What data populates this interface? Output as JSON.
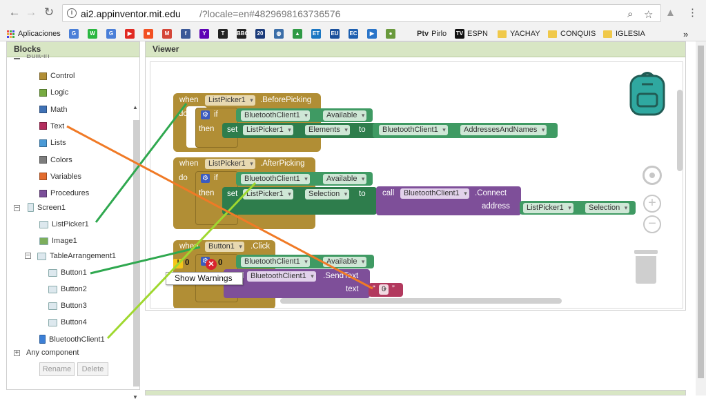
{
  "browser": {
    "url_host": "ai2.appinventor.mit.edu",
    "url_rest": "/?locale=en#4829698163736576",
    "back_icon": "arrow-left-icon",
    "forward_icon": "arrow-right-icon",
    "reload_icon": "reload-icon"
  },
  "bookmarks": {
    "apps_label": "Aplicaciones",
    "items": [
      {
        "label": "",
        "icon": "translate-icon",
        "color": "#4a7fd8",
        "glyph": "G"
      },
      {
        "label": "",
        "icon": "whatsapp-icon",
        "color": "#2bb741",
        "glyph": "W"
      },
      {
        "label": "",
        "icon": "translate-icon-2",
        "color": "#4a7fd8",
        "glyph": "G"
      },
      {
        "label": "",
        "icon": "youtube-icon",
        "color": "#e12a23",
        "glyph": "▶"
      },
      {
        "label": "",
        "icon": "microsoft-icon",
        "color": "#f25022",
        "glyph": "■"
      },
      {
        "label": "",
        "icon": "gmail-icon",
        "color": "#d44638",
        "glyph": "M"
      },
      {
        "label": "",
        "icon": "facebook-icon",
        "color": "#3b5998",
        "glyph": "f"
      },
      {
        "label": "",
        "icon": "yahoo-icon",
        "color": "#5f02b5",
        "glyph": "Y"
      },
      {
        "label": "",
        "icon": "nytimes-icon",
        "color": "#222222",
        "glyph": "T"
      },
      {
        "label": "",
        "icon": "bbc-icon",
        "color": "#222222",
        "glyph": "BBC"
      },
      {
        "label": "",
        "icon": "20min-icon",
        "color": "#1b3b7a",
        "glyph": "20"
      },
      {
        "label": "",
        "icon": "globe-icon",
        "color": "#3b6ea8",
        "glyph": "◍"
      },
      {
        "label": "",
        "icon": "photo-icon",
        "color": "#2f9a45",
        "glyph": "▲"
      },
      {
        "label": "",
        "icon": "et-icon",
        "color": "#1a76c2",
        "glyph": "ET"
      },
      {
        "label": "",
        "icon": "eu-icon",
        "color": "#1a4f9b",
        "glyph": "EU"
      },
      {
        "label": "",
        "icon": "ec-icon",
        "color": "#1d5fb0",
        "glyph": "EC"
      },
      {
        "label": "",
        "icon": "play-icon",
        "color": "#2a75c9",
        "glyph": "▶"
      },
      {
        "label": "",
        "icon": "circle-icon",
        "color": "#6a9a3d",
        "glyph": "●"
      }
    ],
    "pirlo": "Pirlo",
    "espn": "ESPN",
    "yachay": "YACHAY",
    "conquis": "CONQUIS",
    "iglesia": "IGLESIA",
    "more": "»"
  },
  "blocks_panel": {
    "title": "Blocks",
    "builtin": "Built-in",
    "categories": [
      {
        "label": "Control",
        "color": "#b18e35"
      },
      {
        "label": "Logic",
        "color": "#77ab41"
      },
      {
        "label": "Math",
        "color": "#3f71b5"
      },
      {
        "label": "Text",
        "color": "#b32d5e"
      },
      {
        "label": "Lists",
        "color": "#4a9ad6"
      },
      {
        "label": "Colors",
        "color": "#7d7d7d"
      },
      {
        "label": "Variables",
        "color": "#e36b2d"
      },
      {
        "label": "Procedures",
        "color": "#7b4f99"
      }
    ],
    "screen": "Screen1",
    "components": [
      "ListPicker1",
      "Image1",
      "TableArrangement1",
      "Button1",
      "Button2",
      "Button3",
      "Button4",
      "BluetoothClient1"
    ],
    "any": "Any component",
    "rename": "Rename",
    "delete": "Delete"
  },
  "viewer": {
    "title": "Viewer",
    "warnings": "Show Warnings",
    "warn_count": "0",
    "err_count": "0"
  },
  "kw": {
    "when": "when",
    "do": "do",
    "if": "if",
    "then": "then",
    "set": "set",
    "to": "to",
    "call": "call",
    "address": "address",
    "text": "text"
  },
  "blocks": {
    "listpicker": "ListPicker1",
    "before": ".BeforePicking",
    "after": ".AfterPicking",
    "bt": "BluetoothClient1",
    "available": "Available",
    "elements": "Elements",
    "addresses": "AddressesAndNames",
    "selection": "Selection",
    "connect": ".Connect",
    "button1": "Button1",
    "click": ".Click",
    "sendtext": ".SendText",
    "zero": "0",
    "dot": "."
  }
}
